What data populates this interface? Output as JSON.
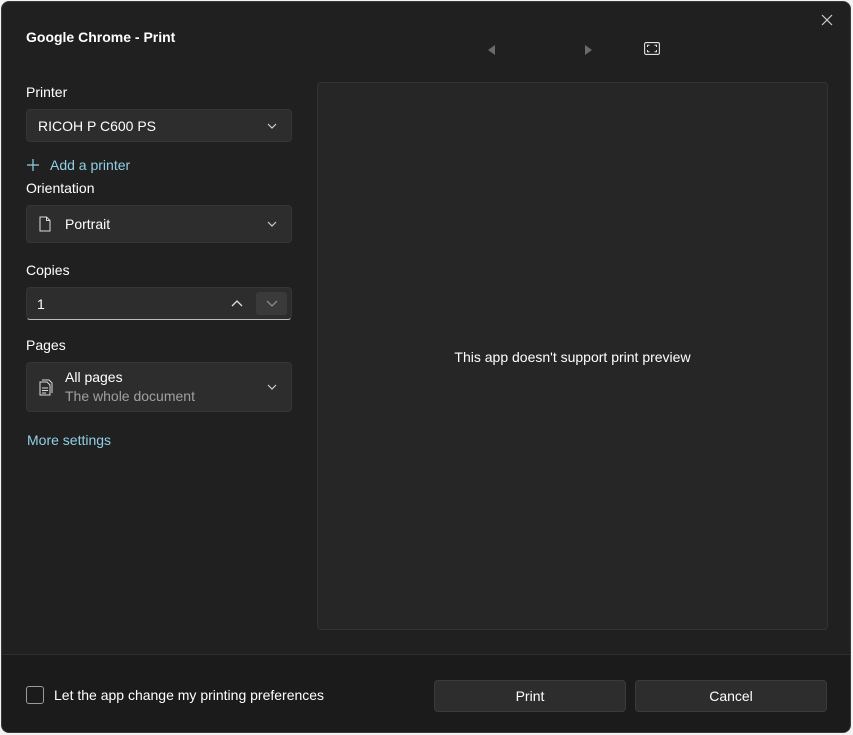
{
  "window": {
    "title": "Google Chrome - Print"
  },
  "printer": {
    "label": "Printer",
    "selected": "RICOH P C600 PS",
    "add_label": "Add a printer"
  },
  "orientation": {
    "label": "Orientation",
    "selected": "Portrait"
  },
  "copies": {
    "label": "Copies",
    "value": "1"
  },
  "pages": {
    "label": "Pages",
    "selected": "All pages",
    "description": "The whole document"
  },
  "more_settings": "More settings",
  "preview": {
    "message": "This app doesn't support print preview"
  },
  "footer": {
    "checkbox_label": "Let the app change my printing preferences",
    "checkbox_checked": false,
    "print_label": "Print",
    "cancel_label": "Cancel"
  },
  "colors": {
    "dialog_bg": "#202020",
    "control_bg": "#2d2d2d",
    "link": "#8fd0e6"
  }
}
